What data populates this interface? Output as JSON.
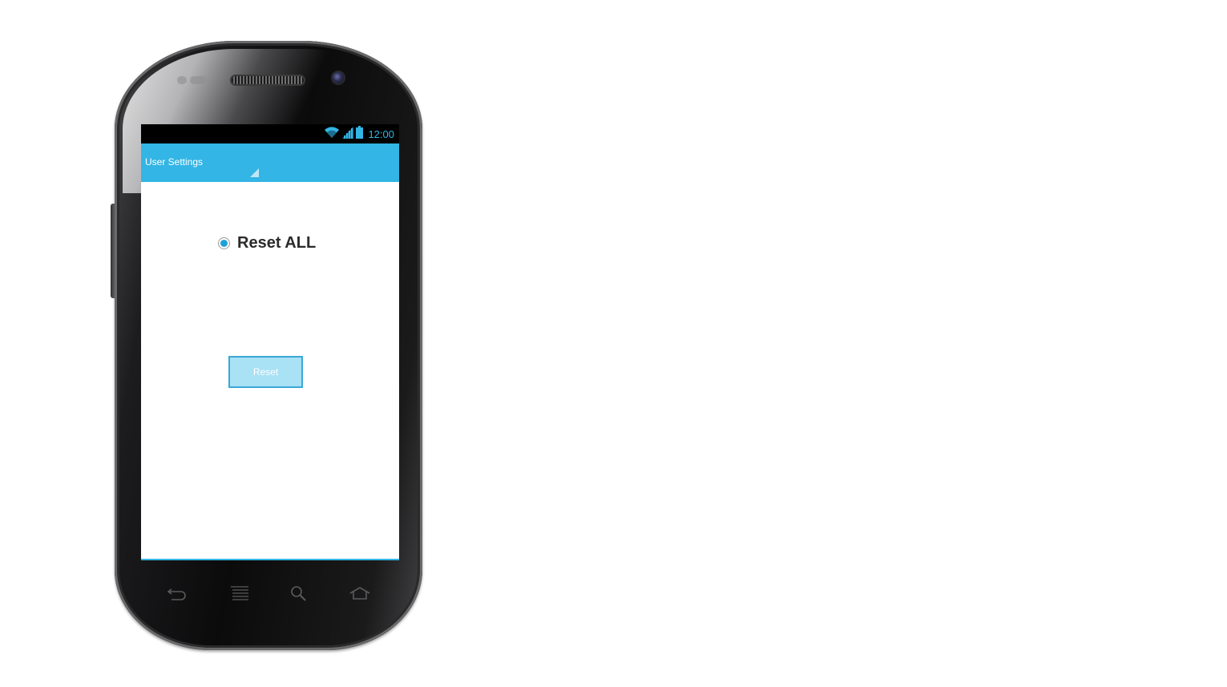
{
  "status_bar": {
    "time": "12:00",
    "icons": [
      "wifi-icon",
      "cell-signal-icon",
      "battery-icon"
    ],
    "accent_color": "#33b5e5"
  },
  "action_bar": {
    "title": "User Settings",
    "color": "#33b5e5"
  },
  "content": {
    "radio": {
      "label": "Reset ALL",
      "checked": true
    },
    "reset_button": {
      "label": "Reset"
    }
  },
  "hardware_keys": [
    "back-icon",
    "menu-icon",
    "search-icon",
    "home-icon"
  ]
}
